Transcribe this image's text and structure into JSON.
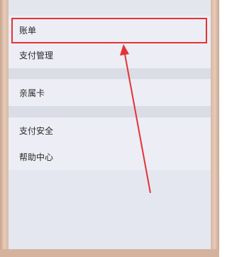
{
  "menu": {
    "items": [
      {
        "label": "账单"
      },
      {
        "label": "支付管理"
      },
      {
        "label": "亲属卡"
      },
      {
        "label": "支付安全"
      },
      {
        "label": "帮助中心"
      }
    ]
  },
  "annotation": {
    "highlight_color": "#e23434",
    "highlighted_item": "账单"
  }
}
